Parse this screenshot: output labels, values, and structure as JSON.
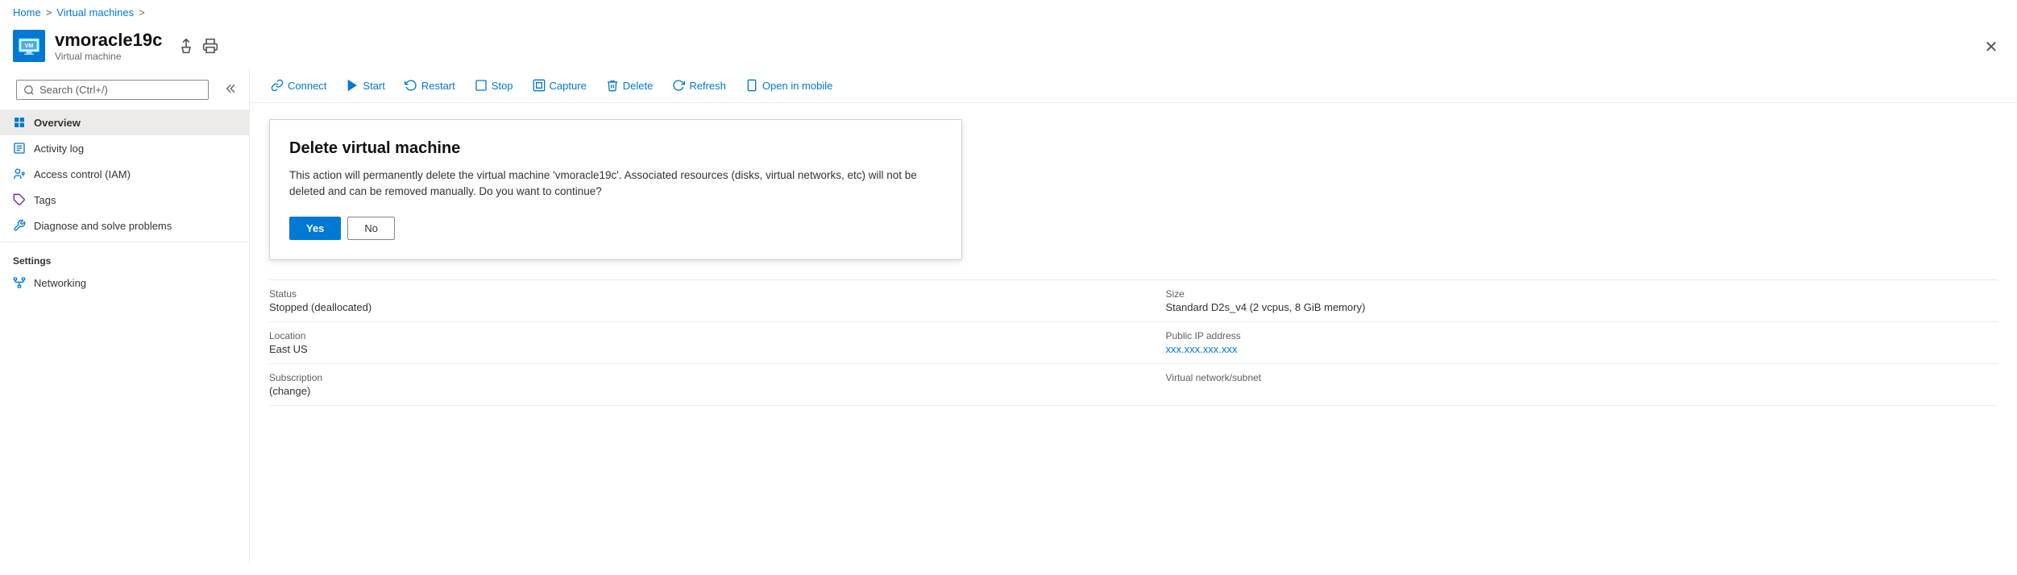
{
  "breadcrumb": {
    "home": "Home",
    "sep1": ">",
    "virtual_machines": "Virtual machines",
    "sep2": ">"
  },
  "header": {
    "vm_name": "vmoracle19c",
    "vm_type": "Virtual machine"
  },
  "toolbar": {
    "connect": "Connect",
    "start": "Start",
    "restart": "Restart",
    "stop": "Stop",
    "capture": "Capture",
    "delete": "Delete",
    "refresh": "Refresh",
    "open_in_mobile": "Open in mobile"
  },
  "sidebar": {
    "search_placeholder": "Search (Ctrl+/)",
    "nav_items": [
      {
        "id": "overview",
        "label": "Overview",
        "active": true
      },
      {
        "id": "activity-log",
        "label": "Activity log",
        "active": false
      },
      {
        "id": "access-control",
        "label": "Access control (IAM)",
        "active": false
      },
      {
        "id": "tags",
        "label": "Tags",
        "active": false
      },
      {
        "id": "diagnose",
        "label": "Diagnose and solve problems",
        "active": false
      }
    ],
    "settings_section": "Settings",
    "networking": "Networking"
  },
  "dialog": {
    "title": "Delete virtual machine",
    "body": "This action will permanently delete the virtual machine 'vmoracle19c'. Associated resources (disks, virtual networks, etc) will not be deleted and can be removed manually. Do you want to continue?",
    "yes_label": "Yes",
    "no_label": "No"
  },
  "vm_details": [
    {
      "label": "Status",
      "value": "Stopped (deallocated)",
      "link": false,
      "side": "left"
    },
    {
      "label": "Size",
      "value": "Standard D2s_v4 (2 vcpus, 8 GiB memory)",
      "link": false,
      "side": "right"
    },
    {
      "label": "Location",
      "value": "East US",
      "link": false,
      "side": "left"
    },
    {
      "label": "Public IP address",
      "value": "xxx.xxx.xxx.xxx",
      "link": true,
      "side": "right"
    },
    {
      "label": "Subscription",
      "value": "(change)",
      "link": true,
      "side": "left",
      "prefix": ""
    },
    {
      "label": "Virtual network/subnet",
      "value": "",
      "link": false,
      "side": "right"
    }
  ]
}
